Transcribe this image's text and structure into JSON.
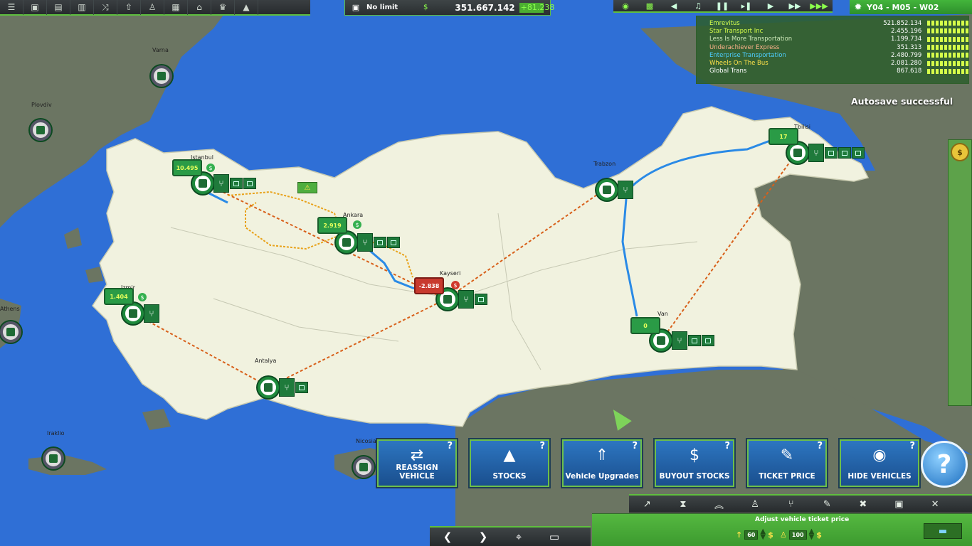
{
  "topbar": {
    "left_icons": [
      "menu-icon",
      "bus-icon",
      "list-icon",
      "train-icon",
      "route-icon",
      "upgrade-icon",
      "person-icon",
      "calendar-icon",
      "bank-icon",
      "trophy-icon",
      "chart-icon"
    ],
    "limit_label": "No limit",
    "money": "351.667.142",
    "money_delta": "+81.238",
    "right_icons": [
      "eye-icon",
      "map-icon",
      "sound-icon",
      "music-icon",
      "pause-icon",
      "step-icon",
      "play-icon",
      "fast-forward-icon",
      "fastest-forward-icon"
    ],
    "date": "Y04 - M05 - W02"
  },
  "leaderboard": [
    {
      "name": "Emrevitus",
      "money": "521.852.134",
      "color": "#d6ff4a"
    },
    {
      "name": "Star Transport Inc",
      "money": "2.455.196",
      "color": "#d6ff4a"
    },
    {
      "name": "Less Is More Transportation",
      "money": "1.199.734",
      "color": "#cde8b8"
    },
    {
      "name": "Underachiever Express",
      "money": "351.313",
      "color": "#ffb38a"
    },
    {
      "name": "Enterprise Transportation",
      "money": "2.480.799",
      "color": "#4ecfff"
    },
    {
      "name": "Wheels On The Bus",
      "money": "2.081.280",
      "color": "#ffe34a"
    },
    {
      "name": "Global Trans",
      "money": "867.618",
      "color": "#ffffff"
    }
  ],
  "notification": "Autosave successful",
  "cities": {
    "varna": "Varna",
    "plovdiv": "Plovdiv",
    "istanbul": "Istanbul",
    "ankara": "Ankara",
    "kayseri": "Kayseri",
    "izmir": "Izmir",
    "athens": "Athens",
    "antalya": "Antalya",
    "trabzon": "Trabzon",
    "tbilisi": "Tbilisi",
    "van": "Van",
    "nicosia": "Nicosia",
    "iraklio": "Iraklio"
  },
  "vehicle_labels": {
    "istanbul": "10.495",
    "ankara": "2.919",
    "kayseri": "-2.838",
    "izmir": "1.404",
    "van": "0",
    "tbilisi": "17"
  },
  "actions": [
    {
      "label": "REASSIGN VEHICLE",
      "icon": "reassign-vehicle-icon"
    },
    {
      "label": "STOCKS",
      "icon": "stocks-icon"
    },
    {
      "label": "Vehicle Upgrades",
      "icon": "vehicle-upgrades-icon"
    },
    {
      "label": "BUYOUT STOCKS",
      "icon": "buyout-stocks-icon"
    },
    {
      "label": "TICKET PRICE",
      "icon": "ticket-price-icon"
    },
    {
      "label": "HIDE VEHICLES",
      "icon": "hide-vehicles-icon"
    }
  ],
  "help_symbol": "?",
  "ticket_panel": {
    "title": "Adjust vehicle ticket price",
    "value_a": "60",
    "value_b": "100",
    "currency": "$"
  },
  "colors": {
    "sea": "#2f6fd6",
    "land": "#f1f2df",
    "ui_green": "#3fa33b",
    "action_blue": "#1f5fa8"
  }
}
